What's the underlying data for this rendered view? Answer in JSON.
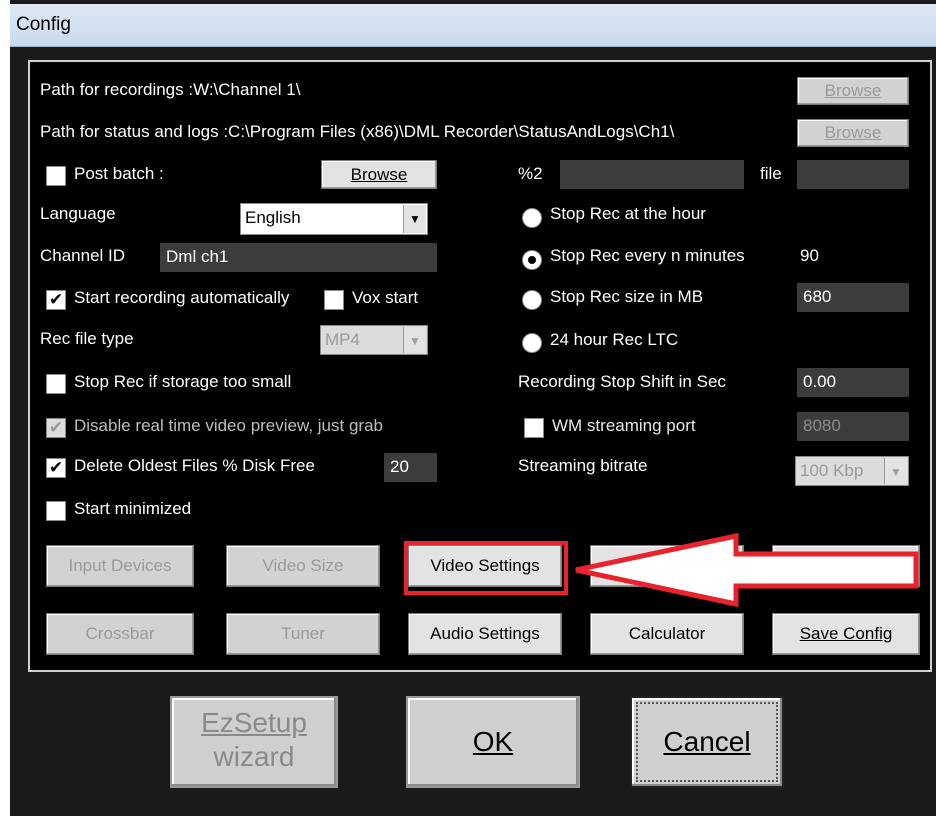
{
  "window": {
    "title": "Config"
  },
  "paths": {
    "recordings_label": "Path for recordings :W:\\Channel 1\\",
    "recordings_browse": "Browse",
    "status_label": "Path for status and logs :C:\\Program Files (x86)\\DML Recorder\\StatusAndLogs\\Ch1\\",
    "status_browse": "Browse"
  },
  "left": {
    "post_batch": {
      "label": "Post batch :",
      "checked": false,
      "browse": "Browse"
    },
    "language": {
      "label": "Language",
      "value": "English"
    },
    "channel_id": {
      "label": "Channel ID",
      "value": "Dml ch1"
    },
    "start_rec_auto": {
      "label": "Start recording automatically",
      "checked": true
    },
    "vox_start": {
      "label": "Vox start",
      "checked": false
    },
    "rec_file_type": {
      "label": "Rec file type",
      "value": "MP4"
    },
    "stop_rec_storage": {
      "label": "Stop Rec if storage too small",
      "checked": false
    },
    "disable_preview": {
      "label": "Disable real time video preview, just grab",
      "checked": true
    },
    "delete_oldest": {
      "label": "Delete Oldest Files % Disk Free",
      "checked": true,
      "value": "20"
    },
    "start_minimized": {
      "label": "Start minimized",
      "checked": false
    }
  },
  "right": {
    "pct2": {
      "label": "%2",
      "file_label": "file"
    },
    "stop_hour": {
      "label": "Stop Rec at the hour"
    },
    "stop_n_min": {
      "label": "Stop Rec every n minutes",
      "value": "90",
      "selected": true
    },
    "stop_size": {
      "label": "Stop Rec size in MB",
      "value": "680"
    },
    "rec_ltc": {
      "label": "24 hour Rec LTC"
    },
    "stop_shift": {
      "label": "Recording Stop Shift in Sec",
      "value": "0.00"
    },
    "wm_port": {
      "label": "WM streaming port",
      "value": "8080",
      "checked": false
    },
    "bitrate": {
      "label": "Streaming bitrate",
      "value": "100 Kbp"
    }
  },
  "buttons_row1": [
    "Input Devices",
    "Video Size",
    "Video Settings"
  ],
  "buttons_row2": [
    "Crossbar",
    "Tuner",
    "Audio Settings",
    "Calculator",
    "Save Config"
  ],
  "footer": {
    "ezsetup_line1": "EzSetup",
    "ezsetup_line2": "wizard",
    "ok": "OK",
    "cancel": "Cancel"
  },
  "colors": {
    "highlight_border": "#e8232b",
    "arrow_fill": "#ffffff",
    "arrow_stroke": "#e8232b"
  }
}
